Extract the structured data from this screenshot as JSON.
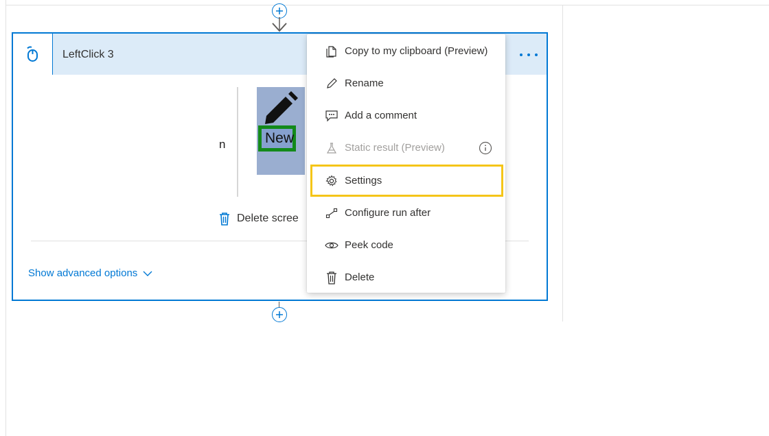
{
  "card": {
    "title": "LeftClick 3",
    "field_label": "n",
    "screenshot_text": "New",
    "delete_screenshot_label": "Delete scree",
    "show_advanced_label": "Show advanced options",
    "more_label": "..."
  },
  "context_menu": {
    "items": [
      {
        "label": "Copy to my clipboard (Preview)",
        "icon": "copy-icon",
        "enabled": true
      },
      {
        "label": "Rename",
        "icon": "pencil-icon",
        "enabled": true
      },
      {
        "label": "Add a comment",
        "icon": "comment-icon",
        "enabled": true
      },
      {
        "label": "Static result (Preview)",
        "icon": "flask-icon",
        "enabled": false
      },
      {
        "label": "Settings",
        "icon": "gear-icon",
        "enabled": true,
        "highlighted": true
      },
      {
        "label": "Configure run after",
        "icon": "run-after-icon",
        "enabled": true
      },
      {
        "label": "Peek code",
        "icon": "eye-icon",
        "enabled": true
      },
      {
        "label": "Delete",
        "icon": "trash-icon",
        "enabled": true
      }
    ]
  },
  "colors": {
    "accent": "#0078d4",
    "header_bg": "#dcebf8",
    "highlight": "#f5c518",
    "screenshot_box": "#138a1a"
  }
}
